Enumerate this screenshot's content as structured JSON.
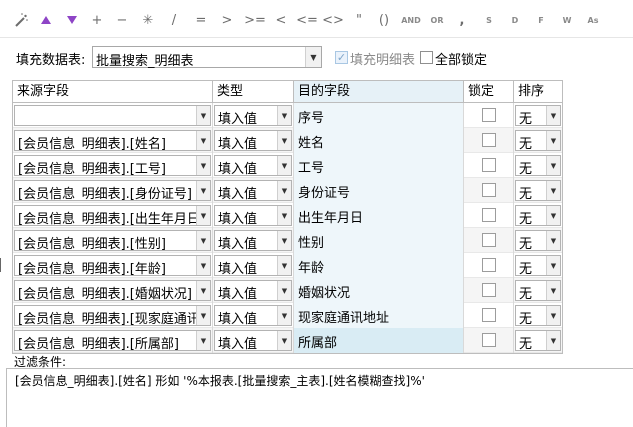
{
  "toolbar": {
    "tokens": {
      "plus": "+",
      "minus": "−",
      "star": "✳",
      "slash": "/",
      "eq": "=",
      "gt": ">",
      "gte": ">=",
      "lt": "<",
      "lte": "<=",
      "ne": "<>",
      "dquote": "\"",
      "paren": "()",
      "and": "AND",
      "or": "OR",
      "comma": ",",
      "s": "S",
      "d": "D",
      "f": "F",
      "w": "W",
      "as": "As"
    }
  },
  "top": {
    "fill_table_label": "填充数据表:",
    "fill_table_value": "批量搜索_明细表",
    "fill_detail_label": "填充明细表",
    "fill_detail_checked": true,
    "lock_all_label": "全部锁定",
    "lock_all_checked": false
  },
  "grid": {
    "headers": [
      "来源字段",
      "类型",
      "目的字段",
      "锁定",
      "排序"
    ],
    "rows": [
      {
        "source": "",
        "type": "填入值",
        "target": "序号",
        "sort": "无"
      },
      {
        "source": "[会员信息_明细表].[姓名]",
        "type": "填入值",
        "target": "姓名",
        "sort": "无"
      },
      {
        "source": "[会员信息_明细表].[工号]",
        "type": "填入值",
        "target": "工号",
        "sort": "无"
      },
      {
        "source": "[会员信息_明细表].[身份证号]",
        "type": "填入值",
        "target": "身份证号",
        "sort": "无"
      },
      {
        "source": "[会员信息_明细表].[出生年月日]",
        "type": "填入值",
        "target": "出生年月日",
        "sort": "无"
      },
      {
        "source": "[会员信息_明细表].[性别]",
        "type": "填入值",
        "target": "性别",
        "sort": "无"
      },
      {
        "source": "[会员信息_明细表].[年龄]",
        "type": "填入值",
        "target": "年龄",
        "sort": "无"
      },
      {
        "source": "[会员信息_明细表].[婚姻状况]",
        "type": "填入值",
        "target": "婚姻状况",
        "sort": "无"
      },
      {
        "source": "[会员信息_明细表].[现家庭通讯地址]",
        "type": "填入值",
        "target": "现家庭通讯地址",
        "sort": "无"
      },
      {
        "source": "[会员信息_明细表].[所属部]",
        "type": "填入值",
        "target": "所属部",
        "sort": "无"
      }
    ]
  },
  "filter": {
    "label": "过滤条件:",
    "text": "[会员信息_明细表].[姓名]  形如  '%本报表.[批量搜索_主表].[姓名模糊查找]%'"
  },
  "colors": {
    "accent_purple": "#8e44c6",
    "highlight_column": "#e6f1f7"
  }
}
